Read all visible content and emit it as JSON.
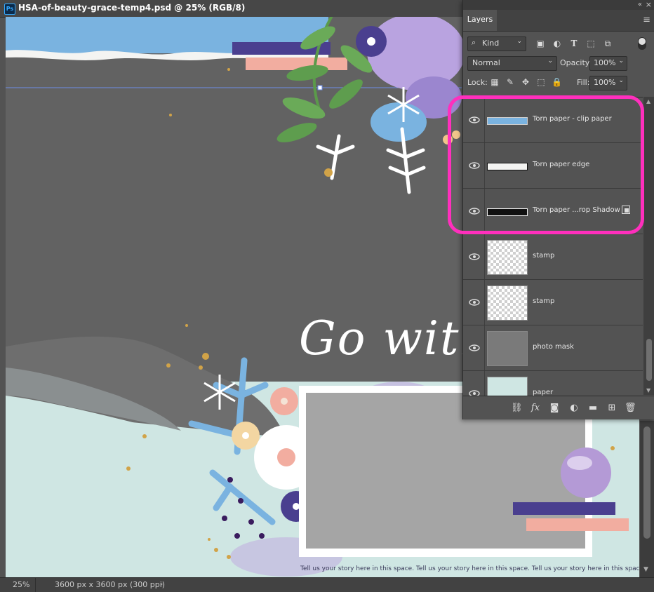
{
  "document": {
    "title": "HSA-of-beauty-grace-temp4.psd @ 25% (RGB/8)",
    "app_icon": "Ps"
  },
  "canvas": {
    "script_text": "Go with",
    "story_text": "Tell us your story here in this space. Tell us your story here in this space. Tell us your story here in this space."
  },
  "status_bar": {
    "zoom": "25%",
    "dimensions": "3600 px x 3600 px (300 ppi)",
    "chevron": "›"
  },
  "layers_panel": {
    "tab_label": "Layers",
    "collapse": "«",
    "close": "×",
    "menu": "≡",
    "filter": {
      "kind_label": "Kind",
      "icons": [
        "image-filter-icon",
        "adjustment-filter-icon",
        "type-filter-icon",
        "shape-filter-icon",
        "smart-object-filter-icon"
      ]
    },
    "blend_mode": "Normal",
    "opacity_label": "Opacity:",
    "opacity_value": "100%",
    "lock_label": "Lock:",
    "fill_label": "Fill:",
    "fill_value": "100%",
    "layers": [
      {
        "name": "Torn paper - clip paper",
        "thumb": "strip-blue"
      },
      {
        "name": "Torn paper edge",
        "thumb": "strip-white"
      },
      {
        "name": "Torn paper ...rop Shadow",
        "thumb": "strip-black",
        "smart_object": true
      },
      {
        "name": "stamp",
        "thumb": "checker"
      },
      {
        "name": "stamp",
        "thumb": "checker"
      },
      {
        "name": "photo mask",
        "thumb": "mask"
      },
      {
        "name": "paper",
        "thumb": "paper"
      }
    ]
  },
  "colors": {
    "highlight": "#ff2fbd",
    "panel_bg": "#535353",
    "canvas_gray": "#626262",
    "mint_paper": "#cfe6e3",
    "sky_blue": "#7ab3e0",
    "navy": "#4a3f8f",
    "peach": "#f2ada0"
  }
}
